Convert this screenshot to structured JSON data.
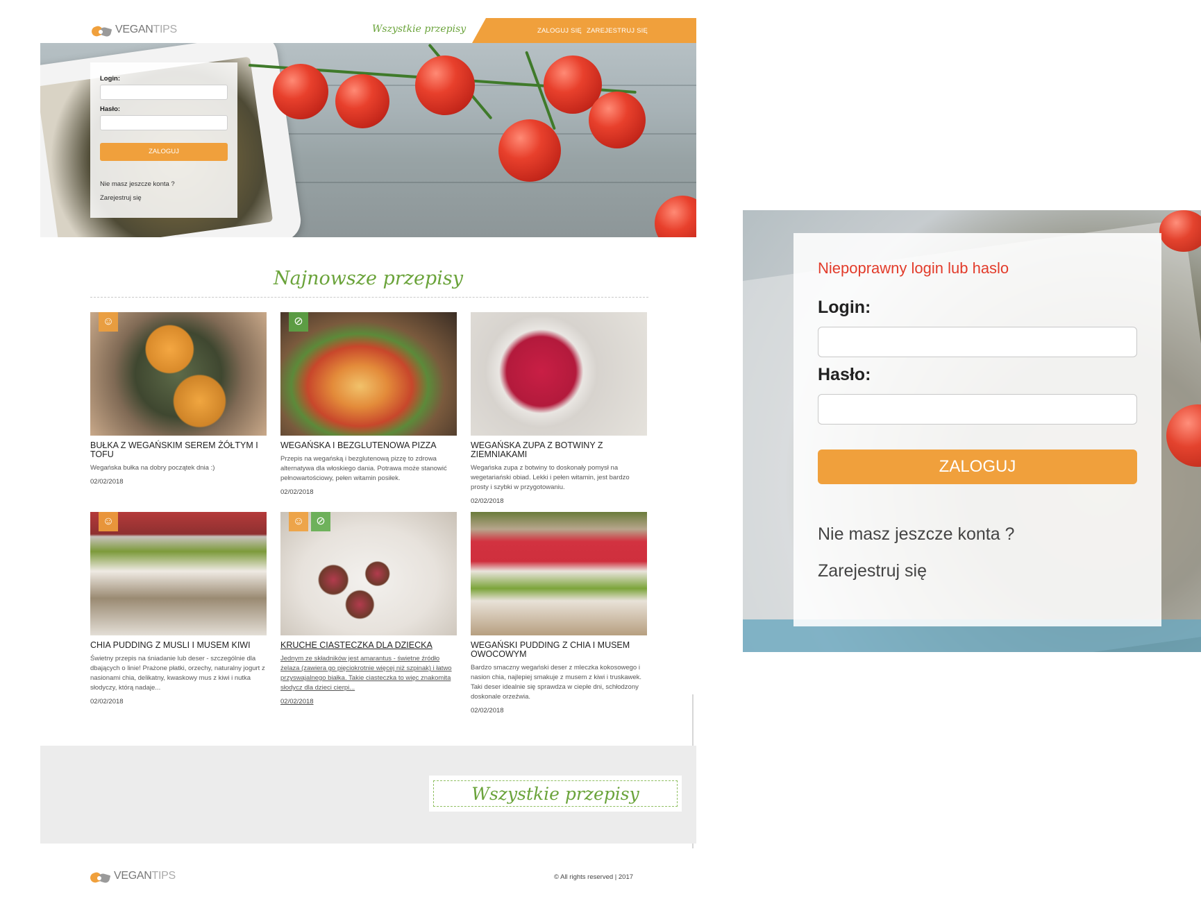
{
  "brand": {
    "part1": "VEGAN",
    "part2": "TIPS"
  },
  "header": {
    "all_recipes": "Wszystkie przepisy",
    "login": "ZALOGUJ SIĘ",
    "register": "ZAREJESTRUJ SIĘ"
  },
  "login_form": {
    "login_label": "Login:",
    "password_label": "Hasło:",
    "submit": "ZALOGUJ",
    "no_account": "Nie masz jeszcze konta ?",
    "register": "Zarejestruj się"
  },
  "section": {
    "title": "Najnowsze przepisy"
  },
  "recipes": [
    {
      "title": "BUŁKA Z WEGAŃSKIM SEREM ŻÓŁTYM I TOFU",
      "desc": "Wegańska bułka na dobry początek dnia :)",
      "date": "02/02/2018",
      "badges": [
        "child-icon"
      ]
    },
    {
      "title": "WEGAŃSKA I BEZGLUTENOWA PIZZA",
      "desc": "Przepis na wegańską i bezglutenową pizzę to zdrowa alternatywa dla włoskiego dania. Potrawa może stanowić pełnowartościowy, pełen witamin posiłek.",
      "date": "02/02/2018",
      "badges": [
        "gluten-free-icon"
      ]
    },
    {
      "title": "WEGAŃSKA ZUPA Z BOTWINY Z ZIEMNIAKAMI",
      "desc": "Wegańska zupa z botwiny to doskonały pomysł na wegetariański obiad. Lekki i pełen witamin, jest bardzo prosty i szybki w przygotowaniu.",
      "date": "02/02/2018",
      "badges": []
    },
    {
      "title": "CHIA PUDDING Z MUSLI I MUSEM KIWI",
      "desc": "Świetny przepis na śniadanie lub deser - szczególnie dla dbających o linie! Prażone płatki, orzechy, naturalny jogurt z nasionami chia, delikatny, kwaskowy mus z kiwi i nutka słodyczy, którą nadaje...",
      "date": "02/02/2018",
      "badges": [
        "child-icon"
      ]
    },
    {
      "title": "KRUCHE CIASTECZKA DLA DZIECKA",
      "desc": "Jednym ze składników jest amarantus - świetne źródło żelaza (zawiera go pięciokrotnie więcej niż szpinak) i łatwo przyswajalnego białka. Takie ciasteczka to więc znakomita słodycz dla dzieci cierpi...",
      "date": "02/02/2018",
      "badges": [
        "child-icon",
        "gluten-free-icon"
      ]
    },
    {
      "title": "WEGAŃSKI PUDDING Z CHIA I MUSEM OWOCOWYM",
      "desc": "Bardzo smaczny wegański deser z mleczka kokosowego i nasion chia, najlepiej smakuje z musem z kiwi i truskawek. Taki deser idealnie się sprawdza w ciepłe dni, schłodzony doskonale orzeźwia.",
      "date": "02/02/2018",
      "badges": []
    }
  ],
  "footer": {
    "all_recipes": "Wszystkie przepisy",
    "copyright": "© All rights reserved | 2017"
  },
  "zoom_panel": {
    "error": "Niepoprawny login lub haslo",
    "login_label": "Login:",
    "password_label": "Hasło:",
    "submit": "ZALOGUJ",
    "no_account": "Nie masz jeszcze konta ?",
    "register": "Zarejestruj się"
  },
  "colors": {
    "orange": "#f0a03c",
    "green": "#6aa33a",
    "error_red": "#e23b2a",
    "footer_gray": "#ececec"
  }
}
